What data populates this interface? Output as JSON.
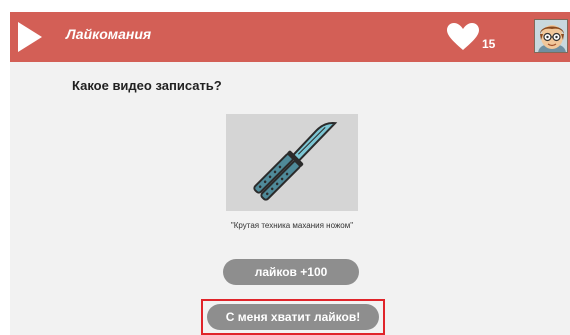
{
  "header": {
    "app_title": "Лайкомания",
    "like_count": "15",
    "play_icon": "play-icon",
    "heart_icon": "heart-icon",
    "avatar_icon": "avatar-icon",
    "bar_color": "#d35f56"
  },
  "main": {
    "question": "Какое видео записать?",
    "video": {
      "image_icon": "butterfly-knife-icon",
      "title": "\"Крутая техника махания ножом\""
    },
    "likes_button_label": "лайков +100",
    "enough_button_label": "С меня хватит лайков!"
  },
  "colors": {
    "button": "#8e8e8e",
    "highlight": "#e0242a",
    "background": "#f2f2f2"
  }
}
